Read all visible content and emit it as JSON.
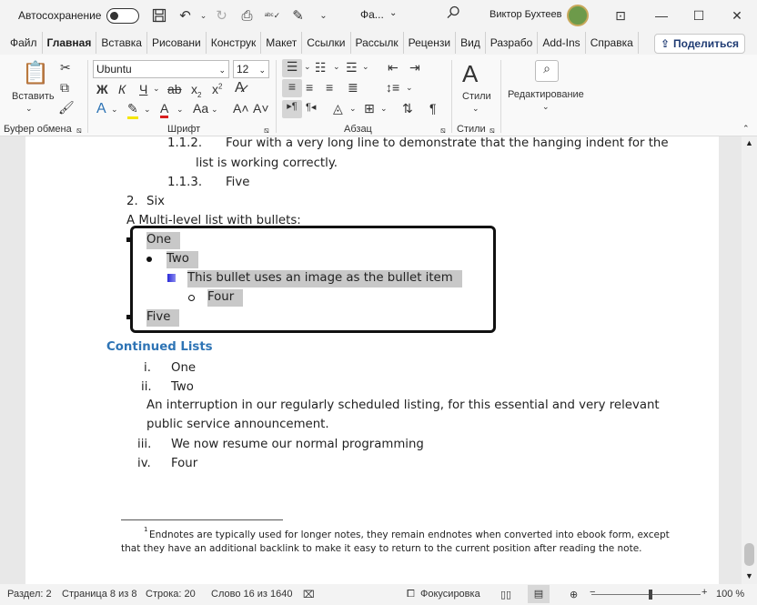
{
  "titlebar": {
    "autosave_label": "Автосохранение",
    "file_name": "Фа...",
    "user_name": "Виктор Бухтеев"
  },
  "tabs": [
    "Файл",
    "Главная",
    "Вставка",
    "Рисовани",
    "Конструк",
    "Макет",
    "Ссылки",
    "Рассылк",
    "Рецензи",
    "Вид",
    "Разрабо",
    "Add-Ins",
    "Справка"
  ],
  "share_label": "Поделиться",
  "ribbon": {
    "paste_label": "Вставить",
    "font_name": "Ubuntu",
    "font_size": "12",
    "bold": "Ж",
    "italic": "К",
    "underline": "Ч",
    "styles_label": "Стили",
    "editing_label": "Редактирование",
    "groups": {
      "clipboard": "Буфер обмена",
      "font": "Шрифт",
      "paragraph": "Абзац",
      "styles": "Стили"
    }
  },
  "document": {
    "item_112_num": "1.1.2.",
    "item_112_text": "Four with a very long line to demonstrate that the hanging indent for the",
    "item_112_cont": "list is working correctly.",
    "item_113_num": "1.1.3.",
    "item_113_text": "Five",
    "item_2_num": "2.",
    "item_2_text": "Six",
    "bullets_intro": "A Multi-level list with bullets:",
    "b1": "One",
    "b2": "Two",
    "b3": "This bullet uses an image as the bullet item",
    "b4": "Four",
    "b5": "Five",
    "heading": "Continued Lists",
    "r1_num": "i.",
    "r1_text": "One",
    "r2_num": "ii.",
    "r2_text": "Two",
    "interruption_1": "An interruption in our regularly scheduled listing, for this essential and very relevant",
    "interruption_2": "public service announcement.",
    "r3_num": "iii.",
    "r3_text": "We now resume our normal programming",
    "r4_num": "iv.",
    "r4_text": "Four",
    "footnote_mark": "1",
    "footnote_1": "Endnotes are typically used for longer notes, they remain endnotes when converted into ebook form, except",
    "footnote_2": "that they have an additional backlink to make it easy to return to the current position after reading the note."
  },
  "status": {
    "section": "Раздел: 2",
    "page": "Страница 8 из 8",
    "line": "Строка: 20",
    "words": "Слово 16 из 1640",
    "focus": "Фокусировка",
    "zoom": "100 %"
  }
}
